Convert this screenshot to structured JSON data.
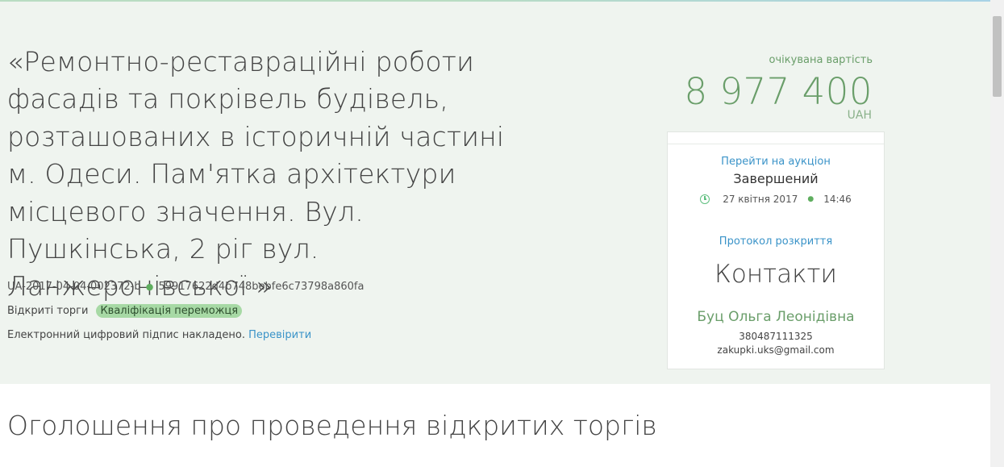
{
  "tender": {
    "title": "«Ремонтно-реставраційні роботи фасадів та покрівель будівель, розташованих в історичній частині м. Одеси. Пам'ятка архітектури місцевого значення. Вул. Пушкінська, 2 ріг вул. Ланжеронівської »",
    "id": "UA-2017-04-04-002372-b",
    "hash": "59917622d4b748bebfe6c73798a860fa",
    "procedure_type": "Відкриті торги",
    "status_badge": "Кваліфікація переможця",
    "signature_text": "Електронний цифровий підпис накладено.",
    "verify_link": "Перевірити"
  },
  "price": {
    "label": "очікувана вартість",
    "amount": "8 977 400",
    "currency": "UAH"
  },
  "auction": {
    "link": "Перейти на аукціон",
    "status": "Завершений",
    "date": "27 квітня 2017",
    "time": "14:46"
  },
  "protocol": {
    "link": "Протокол розкриття"
  },
  "contacts": {
    "title": "Контакти",
    "name": "Буц Ольга Леонідівна",
    "phone": "380487111325",
    "email": "zakupki.uks@gmail.com"
  },
  "announcement": {
    "title": "Оголошення про проведення відкритих торгів"
  },
  "colors": {
    "hero_bg": "#eff4ef",
    "accent_green": "#6a9e6a",
    "link_blue": "#3a93c8",
    "badge_bg": "#a7d9a5"
  },
  "icons": {
    "clock": "clock-icon",
    "dot": "dot-separator"
  }
}
